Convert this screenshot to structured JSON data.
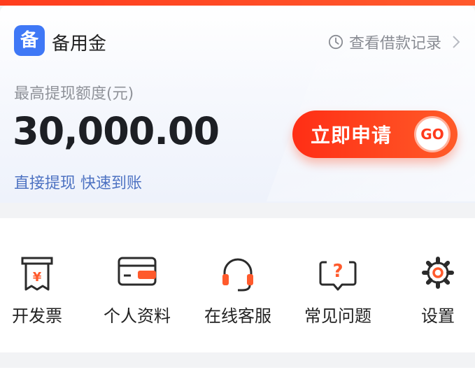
{
  "header": {
    "product_title": "备用金",
    "logo_glyph": "备",
    "record_link_label": "查看借款记录"
  },
  "credit": {
    "limit_label": "最高提现额度(元)",
    "amount": "30,000.00",
    "tagline": "直接提现 快速到账",
    "apply_button_label": "立即申请",
    "go_badge": "GO"
  },
  "menu": [
    {
      "label": "开发票",
      "icon": "invoice-icon"
    },
    {
      "label": "个人资料",
      "icon": "card-icon"
    },
    {
      "label": "在线客服",
      "icon": "headset-icon"
    },
    {
      "label": "常见问题",
      "icon": "question-bubble-icon"
    },
    {
      "label": "设置",
      "icon": "gear-icon"
    }
  ],
  "colors": {
    "accent_red": "#ff3d1e",
    "brand_blue": "#3f78f6",
    "link_blue": "#4d72c2",
    "icon_stroke": "#2b2b2b",
    "icon_accent": "#ff5a2c"
  }
}
